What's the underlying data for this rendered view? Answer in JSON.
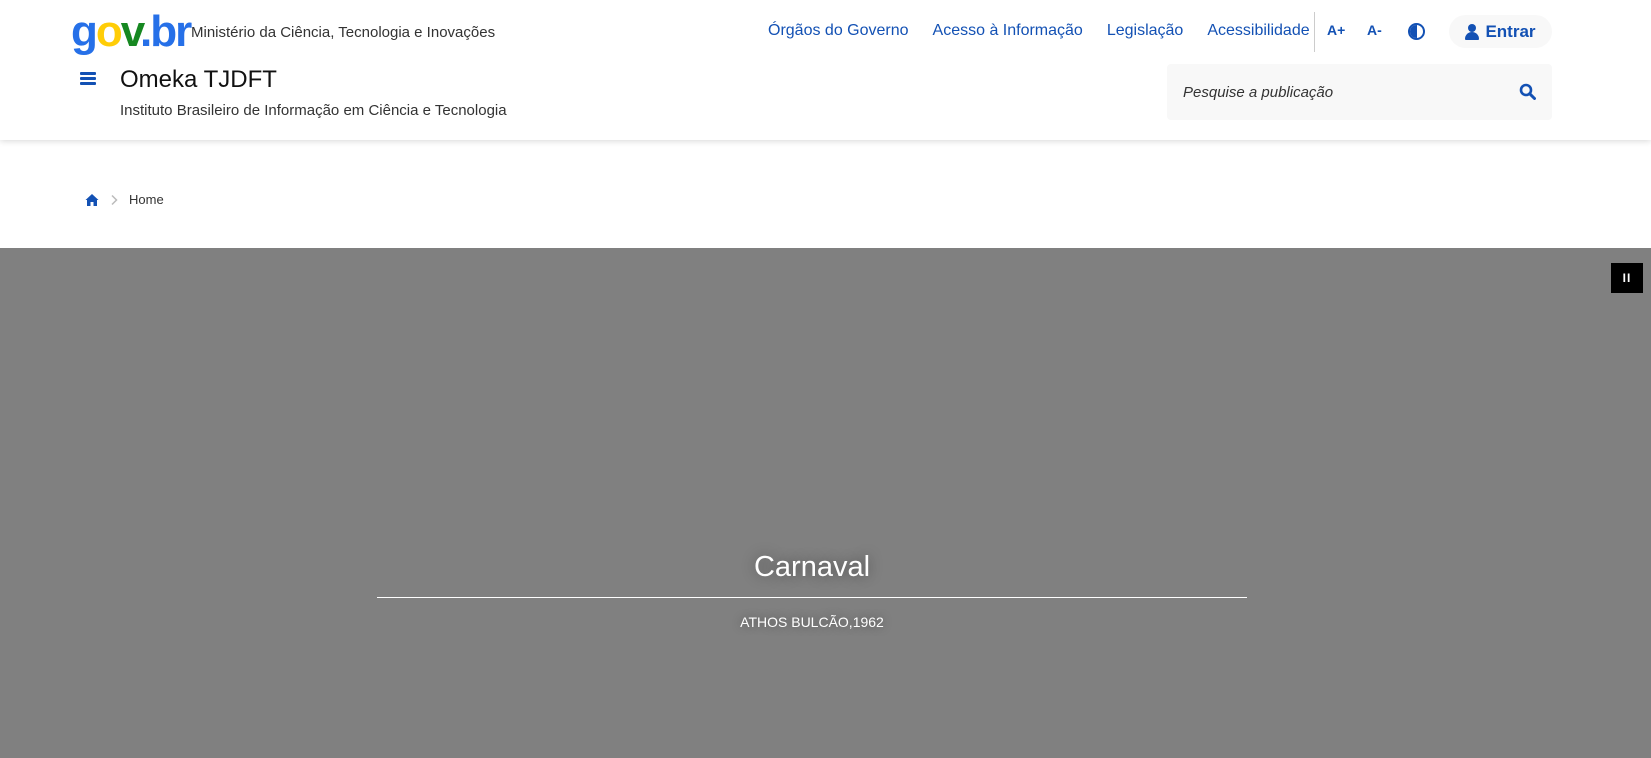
{
  "header": {
    "logo": {
      "g": "g",
      "o": "o",
      "v": "v",
      "dot": ".",
      "b": "b",
      "r": "r"
    },
    "ministry": "Ministério da Ciência, Tecnologia e Inovações",
    "nav": [
      "Órgãos do Governo",
      "Acesso à Informação",
      "Legislação",
      "Acessibilidade"
    ],
    "font_increase_label": "A+",
    "font_decrease_label": "A-",
    "contrast_icon": "contrast-icon",
    "login_label": "Entrar",
    "login_icon": "user-icon",
    "menu_icon": "hamburger-menu-icon",
    "site_title": "Omeka TJDFT",
    "site_subtitle": "Instituto Brasileiro de Informação em Ciência e Tecnologia",
    "search": {
      "placeholder": "Pesquise a publicação",
      "icon": "search-icon"
    }
  },
  "breadcrumb": {
    "home_icon": "home-icon",
    "separator_icon": "chevron-right-icon",
    "current": "Home"
  },
  "hero": {
    "pause_label": "II",
    "title": "Carnaval",
    "caption": "ATHOS BULCÃO,1962",
    "background_color": "#808080"
  },
  "colors": {
    "primary_blue": "#1351B4",
    "gov_blue": "#2670E8",
    "gov_yellow": "#FFCD07",
    "gov_green": "#168821"
  }
}
